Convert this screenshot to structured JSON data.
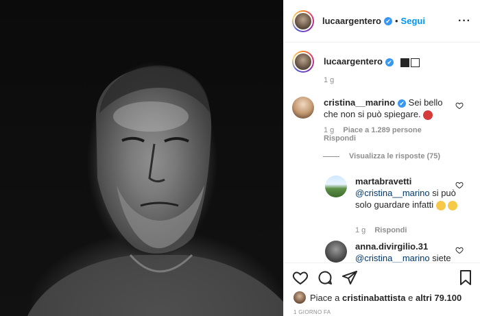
{
  "header": {
    "username": "lucaargentero",
    "verified_mark": "✔",
    "separator": "•",
    "follow_label": "Segui",
    "more_icon": "more-horizontal-icon",
    "more_glyph": "···"
  },
  "caption": {
    "username": "lucaargentero",
    "time": "1 g"
  },
  "comments": [
    {
      "username": "cristina__marino",
      "text": "Sei bello che non si può spiegare.",
      "time": "1 g",
      "likes": "Piace a 1.289 persone",
      "reply": "Rispondi"
    }
  ],
  "view_replies": "Visualizza le risposte (75)",
  "replies": [
    {
      "username": "martabravetti",
      "mention": "@cristina__marino",
      "text": "si può solo guardare infatti",
      "time": "1 g",
      "reply": "Rispondi"
    },
    {
      "username": "anna.divirgilio.31",
      "mention": "@cristina__marino",
      "text": "siete"
    }
  ],
  "bottom": {
    "likes_prefix": "Piace a",
    "liker": "cristinabattista",
    "likes_middle": "e",
    "likes_rest": "altri 79.100",
    "timestamp": "1 GIORNO FA"
  },
  "colors": {
    "link_blue": "#0095f6",
    "verified_blue": "#3897f0",
    "mention": "#00376b",
    "muted": "#8e8e8e"
  }
}
